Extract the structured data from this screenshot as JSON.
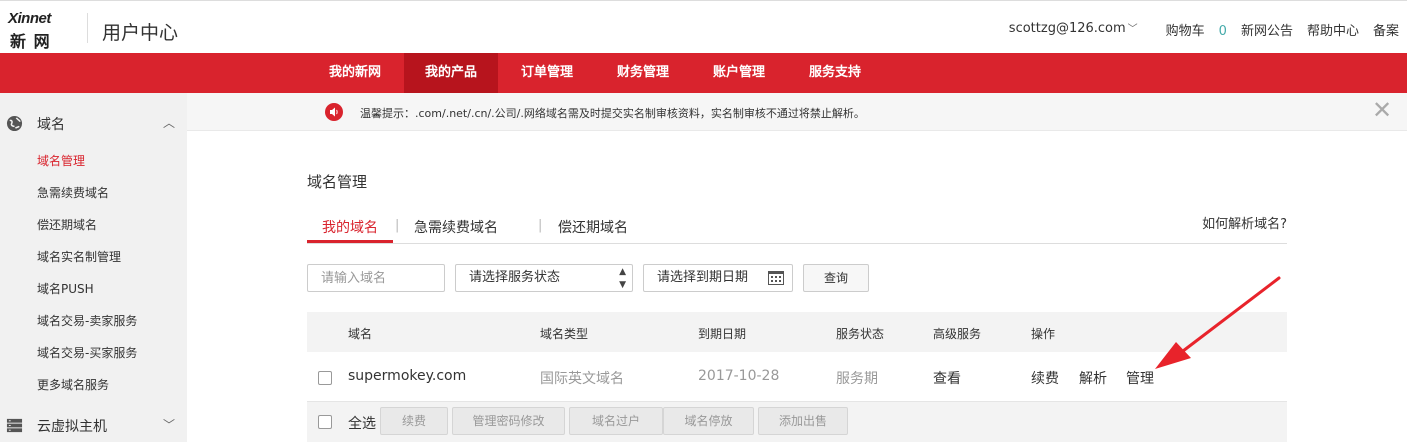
{
  "header": {
    "logo_text_top": "Xinnet",
    "logo_text_bottom": "新 网",
    "title": "用户中心",
    "user_email": "scottzg@126.com",
    "cart_label": "购物车",
    "cart_count": "0",
    "links": [
      "新网公告",
      "帮助中心",
      "备案"
    ]
  },
  "main_nav": {
    "items": [
      "我的新网",
      "我的产品",
      "订单管理",
      "财务管理",
      "账户管理",
      "服务支持"
    ],
    "active": "我的产品"
  },
  "sidebar": {
    "groups": [
      {
        "label": "域名",
        "icon": "globe-icon",
        "expanded": true,
        "items": [
          "域名管理",
          "急需续费域名",
          "偿还期域名",
          "域名实名制管理",
          "域名PUSH",
          "域名交易-卖家服务",
          "域名交易-买家服务",
          "更多域名服务"
        ],
        "active_item": "域名管理"
      },
      {
        "label": "云虚拟主机",
        "icon": "server-icon",
        "expanded": false
      }
    ]
  },
  "notice": {
    "text": "温馨提示：.com/.net/.cn/.公司/.网络域名需及时提交实名制审核资料，实名制审核不通过将禁止解析。"
  },
  "page": {
    "title": "域名管理",
    "tabs": [
      "我的域名",
      "急需续费域名",
      "偿还期域名"
    ],
    "active_tab": "我的域名",
    "help_link": "如何解析域名?"
  },
  "filters": {
    "domain_placeholder": "请输入域名",
    "status_select": "请选择服务状态",
    "date_placeholder": "请选择到期日期",
    "query_label": "查询"
  },
  "table": {
    "columns": [
      "域名",
      "域名类型",
      "到期日期",
      "服务状态",
      "高级服务",
      "操作"
    ],
    "rows": [
      {
        "domain": "supermokey.com",
        "type": "国际英文域名",
        "expiry": "2017-10-28",
        "status": "服务期",
        "advanced": "查看",
        "actions": [
          "续费",
          "解析",
          "管理"
        ]
      }
    ]
  },
  "bulk_actions": {
    "select_all": "全选",
    "buttons": [
      "续费",
      "管理密码修改",
      "域名过户",
      "域名停放",
      "添加出售"
    ]
  },
  "colors": {
    "brand_red": "#d9232d",
    "nav_active": "#b7141d",
    "annotation_arrow": "#e8232b"
  }
}
